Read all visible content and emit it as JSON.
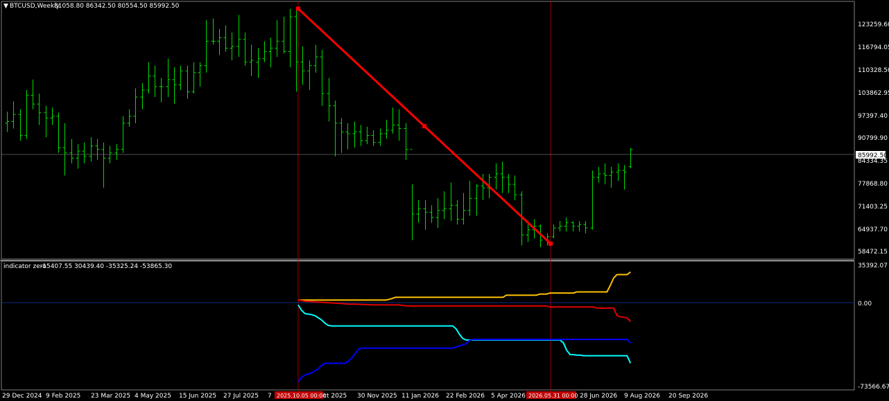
{
  "header": {
    "symbol_timeframe": "BTCUSD,Weekly",
    "ohlc": "81058.80 86342.50 80554.50 85992.50"
  },
  "indicator": {
    "title": "indicator zero",
    "values": "-15407.55 30439.40 -35325.24 -53865.30"
  },
  "price_axis": {
    "labels": [
      "123259.60",
      "116794.05",
      "110328.50",
      "103862.95",
      "97397.40",
      "90799.90",
      "84334.35",
      "77868.80",
      "71403.25",
      "64937.70",
      "58472.15"
    ],
    "current_price": "85992.50"
  },
  "indicator_axis": {
    "labels": [
      "35392.07",
      "0.00",
      "-73566.67"
    ]
  },
  "time_axis": {
    "labels": [
      "29 Dec 2024",
      "9 Feb 2025",
      "23 Mar 2025",
      "4 May 2025",
      "15 Jun 2025",
      "27 Jul 2025",
      "7",
      "ct 2025",
      "30 Nov 2025",
      "11 Jan 2026",
      "22 Feb 2026",
      "5 Apr 2026",
      "28 Jun 2026",
      "9 Aug 2026",
      "20 Sep 2026"
    ],
    "marker_1": "2025.10.05 00:00",
    "marker_2": "2026.05.31 00:00"
  },
  "colors": {
    "bars": "#00dd00",
    "trendline": "#ff0000",
    "line_gold": "#ffc000",
    "line_red": "#e00000",
    "line_cyan": "#00ffff",
    "line_blue": "#0000ff",
    "marker": "#c00000"
  },
  "chart_data": {
    "type": "ohlc-bars + indicator lines",
    "price_bars": [
      [
        93500,
        96800,
        91000,
        94000
      ],
      [
        94000,
        99800,
        92000,
        96000
      ],
      [
        96000,
        97500,
        88500,
        90000
      ],
      [
        90000,
        103000,
        89000,
        101500
      ],
      [
        101500,
        106000,
        97500,
        99000
      ],
      [
        99000,
        102000,
        93000,
        96500
      ],
      [
        96500,
        98500,
        89500,
        95000
      ],
      [
        95000,
        98000,
        93000,
        95500
      ],
      [
        95500,
        96500,
        85000,
        86500
      ],
      [
        86500,
        93500,
        78500,
        85000
      ],
      [
        85000,
        89000,
        82000,
        83500
      ],
      [
        83500,
        87500,
        80500,
        85500
      ],
      [
        85500,
        88000,
        82000,
        84000
      ],
      [
        84000,
        89500,
        82500,
        87000
      ],
      [
        87000,
        89000,
        83000,
        86000
      ],
      [
        86000,
        88000,
        75000,
        83500
      ],
      [
        83500,
        87000,
        82000,
        85000
      ],
      [
        85000,
        87500,
        83000,
        86000
      ],
      [
        86000,
        95500,
        85000,
        93500
      ],
      [
        93500,
        97500,
        92500,
        95500
      ],
      [
        95500,
        103500,
        93500,
        101000
      ],
      [
        101000,
        105000,
        97500,
        103000
      ],
      [
        103000,
        111000,
        102000,
        107000
      ],
      [
        107000,
        110000,
        101000,
        104000
      ],
      [
        104000,
        106500,
        99500,
        104000
      ],
      [
        104000,
        112000,
        101000,
        106000
      ],
      [
        106000,
        109500,
        99000,
        104500
      ],
      [
        104500,
        110000,
        103000,
        108500
      ],
      [
        108500,
        110000,
        100500,
        102500
      ],
      [
        102500,
        111000,
        102000,
        108000
      ],
      [
        108000,
        111000,
        104000,
        110000
      ],
      [
        110000,
        123000,
        108000,
        117000
      ],
      [
        117000,
        123500,
        116000,
        117000
      ],
      [
        117000,
        120500,
        113000,
        118000
      ],
      [
        118000,
        121500,
        114000,
        115000
      ],
      [
        115000,
        119500,
        111500,
        115500
      ],
      [
        115500,
        124500,
        112500,
        117500
      ],
      [
        117500,
        119500,
        110000,
        111000
      ],
      [
        111000,
        116000,
        107000,
        111500
      ],
      [
        111000,
        115000,
        106500,
        112000
      ],
      [
        112000,
        117000,
        111000,
        114000
      ],
      [
        114000,
        118000,
        109500,
        115000
      ],
      [
        115000,
        123000,
        112500,
        117000
      ],
      [
        117000,
        124000,
        113500,
        114000
      ],
      [
        114000,
        126300,
        109500,
        124000
      ],
      [
        124000,
        126300,
        102500,
        111000
      ],
      [
        111000,
        115500,
        104500,
        108500
      ],
      [
        108500,
        111500,
        103000,
        110000
      ],
      [
        110000,
        116000,
        108000,
        112500
      ],
      [
        112500,
        114500,
        98500,
        102000
      ],
      [
        102000,
        106500,
        94000,
        98500
      ],
      [
        98500,
        100000,
        84000,
        93500
      ],
      [
        93500,
        95000,
        85000,
        91000
      ],
      [
        91000,
        93500,
        86000,
        90500
      ],
      [
        90500,
        94000,
        86500,
        91000
      ],
      [
        91000,
        93000,
        87000,
        88500
      ],
      [
        88500,
        92500,
        87500,
        90000
      ],
      [
        90000,
        91500,
        87000,
        88000
      ],
      [
        88000,
        92000,
        87000,
        90500
      ],
      [
        90500,
        94500,
        89000,
        91500
      ],
      [
        91500,
        98000,
        90500,
        93000
      ],
      [
        93000,
        97500,
        88500,
        92000
      ],
      [
        92000,
        93500,
        83000,
        86000
      ],
      [
        86000,
        76000,
        60000,
        67500
      ],
      [
        67500,
        71500,
        65000,
        69000
      ],
      [
        69000,
        71500,
        63000,
        68000
      ],
      [
        68000,
        70000,
        65000,
        66500
      ],
      [
        66500,
        72000,
        63500,
        68500
      ],
      [
        68500,
        74000,
        66000,
        69000
      ],
      [
        69000,
        76500,
        65500,
        70000
      ],
      [
        70000,
        71500,
        64500,
        66000
      ],
      [
        66000,
        73500,
        64500,
        68500
      ],
      [
        68500,
        77000,
        67000,
        72000
      ],
      [
        72000,
        76000,
        67000,
        75500
      ],
      [
        75500,
        79000,
        71500,
        75000
      ],
      [
        75000,
        79000,
        72000,
        78000
      ],
      [
        78000,
        82000,
        74500,
        79000
      ],
      [
        79000,
        82500,
        73500,
        78000
      ],
      [
        78000,
        79000,
        73500,
        76000
      ],
      [
        76000,
        78500,
        71500,
        73000
      ],
      [
        73000,
        74000,
        58500,
        61500
      ],
      [
        61500,
        64500,
        59500,
        63000
      ],
      [
        63000,
        66000,
        60500,
        64000
      ],
      [
        64000,
        64500,
        58000,
        60000
      ],
      [
        60000,
        62000,
        58500,
        61000
      ],
      [
        61000,
        64500,
        60500,
        63500
      ],
      [
        63500,
        65500,
        62500,
        64000
      ],
      [
        64000,
        66500,
        62500,
        65000
      ],
      [
        65000,
        65500,
        62500,
        64000
      ],
      [
        64000,
        65500,
        62500,
        64500
      ],
      [
        64500,
        65500,
        62000,
        63500
      ],
      [
        63500,
        80000,
        63000,
        78000
      ],
      [
        78000,
        81000,
        76500,
        79000
      ],
      [
        79000,
        82000,
        76000,
        78500
      ],
      [
        78500,
        81000,
        75000,
        79500
      ],
      [
        79500,
        82000,
        77000,
        80000
      ],
      [
        80000,
        81500,
        74500,
        79500
      ],
      [
        81058.8,
        86342.5,
        80554.5,
        85992.5
      ]
    ],
    "trendline": {
      "start": [
        "2025.10.05",
        126300
      ],
      "end": [
        "2026.05.31",
        59000
      ]
    },
    "indicator_lines": [
      {
        "color": "gold",
        "values": [
          4500,
          4500,
          4500,
          4500,
          4500,
          4500,
          4500,
          4500,
          4500,
          4500,
          4500,
          4500,
          4500,
          4500,
          4500,
          4500,
          4500,
          4500,
          4500,
          4500,
          4500,
          4500,
          4500,
          4500,
          4500,
          4500,
          4500,
          5000,
          6000,
          7000,
          7000,
          7000,
          7000,
          7000,
          7000,
          7000,
          7000,
          7000,
          7000,
          7000,
          7000,
          7000,
          7000,
          7000,
          7000,
          7000,
          7000,
          7000,
          7000,
          7000,
          7000,
          7000,
          7000,
          7000,
          7000,
          7000,
          7000,
          7000,
          7000,
          7000,
          7000,
          7000,
          9000,
          9000,
          9000,
          9000,
          9000,
          9000,
          9000,
          9000,
          9000,
          9000,
          10000,
          10000,
          10000,
          11000,
          11000,
          11000,
          11000,
          11000,
          11000,
          11000,
          11000,
          12000,
          12000,
          12000,
          12000,
          12000,
          12000,
          12000,
          12000,
          12000,
          12000,
          18000,
          25000,
          28000,
          28000,
          28000,
          28000,
          30439.4
        ]
      },
      {
        "color": "red",
        "values": [
          4500,
          4000,
          3500,
          3200,
          3000,
          2800,
          2600,
          2400,
          2200,
          2000,
          1800,
          1600,
          1400,
          1200,
          1000,
          800,
          700,
          600,
          500,
          400,
          300,
          200,
          100,
          0,
          0,
          0,
          0,
          0,
          0,
          0,
          0,
          -500,
          -800,
          -1000,
          -1000,
          -1000,
          -1000,
          -1000,
          -1000,
          -1000,
          -1000,
          -1000,
          -1000,
          -1000,
          -1000,
          -1000,
          -1000,
          -1000,
          -1000,
          -1000,
          -1000,
          -1000,
          -1000,
          -1000,
          -1000,
          -1000,
          -1000,
          -1000,
          -1000,
          -1000,
          -1000,
          -1000,
          -1000,
          -1000,
          -1000,
          -1000,
          -1000,
          -1000,
          -1000,
          -1000,
          -1000,
          -1000,
          -1000,
          -1000,
          -1000,
          -2000,
          -2000,
          -2000,
          -2000,
          -2000,
          -2000,
          -2000,
          -2000,
          -2000,
          -2000,
          -2000,
          -2000,
          -2000,
          -2000,
          -3000,
          -3000,
          -3000,
          -3000,
          -3000,
          -3000,
          -10000,
          -11000,
          -11500,
          -12000,
          -15407.55
        ]
      },
      {
        "color": "cyan",
        "values": [
          0,
          -5000,
          -8000,
          -8500,
          -9000,
          -10000,
          -12000,
          -14000,
          -17000,
          -19000,
          -19500,
          -19500,
          -19500,
          -19500,
          -19500,
          -19500,
          -19500,
          -19500,
          -19500,
          -19500,
          -19500,
          -19500,
          -19500,
          -19500,
          -19500,
          -19500,
          -19500,
          -19500,
          -19500,
          -19500,
          -19500,
          -19500,
          -19500,
          -19500,
          -19500,
          -19500,
          -19500,
          -19500,
          -19500,
          -19500,
          -19500,
          -19500,
          -19500,
          -19500,
          -19500,
          -19500,
          -19500,
          -22000,
          -27000,
          -31000,
          -32500,
          -32500,
          -32500,
          -32500,
          -32500,
          -32500,
          -32500,
          -32500,
          -32500,
          -32500,
          -32500,
          -32500,
          -32500,
          -32500,
          -32500,
          -32500,
          -32500,
          -32500,
          -32500,
          -32500,
          -32500,
          -32500,
          -32500,
          -32500,
          -32500,
          -32500,
          -32500,
          -32500,
          -32500,
          -35000,
          -42000,
          -46000,
          -46000,
          -46500,
          -46500,
          -47000,
          -47000,
          -47000,
          -47000,
          -47000,
          -47000,
          -47000,
          -47000,
          -47000,
          -47000,
          -47000,
          -47000,
          -47000,
          -47000,
          -53865.3
        ]
      },
      {
        "color": "blue",
        "values": [
          -71000,
          -67000,
          -65000,
          -64000,
          -63000,
          -61000,
          -59000,
          -56000,
          -54000,
          -54000,
          -54000,
          -54000,
          -54000,
          -54000,
          -54000,
          -52000,
          -49000,
          -45000,
          -41000,
          -40000,
          -40000,
          -40000,
          -40000,
          -40000,
          -40000,
          -40000,
          -40000,
          -40000,
          -40000,
          -40000,
          -40000,
          -40000,
          -40000,
          -40000,
          -40000,
          -40000,
          -40000,
          -40000,
          -40000,
          -40000,
          -40000,
          -40000,
          -40000,
          -40000,
          -40000,
          -40000,
          -40000,
          -39000,
          -38000,
          -37000,
          -36000,
          -33000,
          -32000,
          -32000,
          -32000,
          -32000,
          -32000,
          -32000,
          -32000,
          -32000,
          -32000,
          -32000,
          -32000,
          -32000,
          -32000,
          -32000,
          -32000,
          -32000,
          -32000,
          -32000,
          -32000,
          -32000,
          -32000,
          -32000,
          -32000,
          -32000,
          -32000,
          -32000,
          -32000,
          -32000,
          -32000,
          -32000,
          -32000,
          -32000,
          -32000,
          -32000,
          -32000,
          -32000,
          -32000,
          -32000,
          -32000,
          -32000,
          -32000,
          -32000,
          -32000,
          -32000,
          -32000,
          -32000,
          -32000,
          -35325.24
        ]
      }
    ],
    "price_range": [
      55000,
      128000
    ],
    "indicator_range": [
      -73566.67,
      35392.07
    ]
  }
}
